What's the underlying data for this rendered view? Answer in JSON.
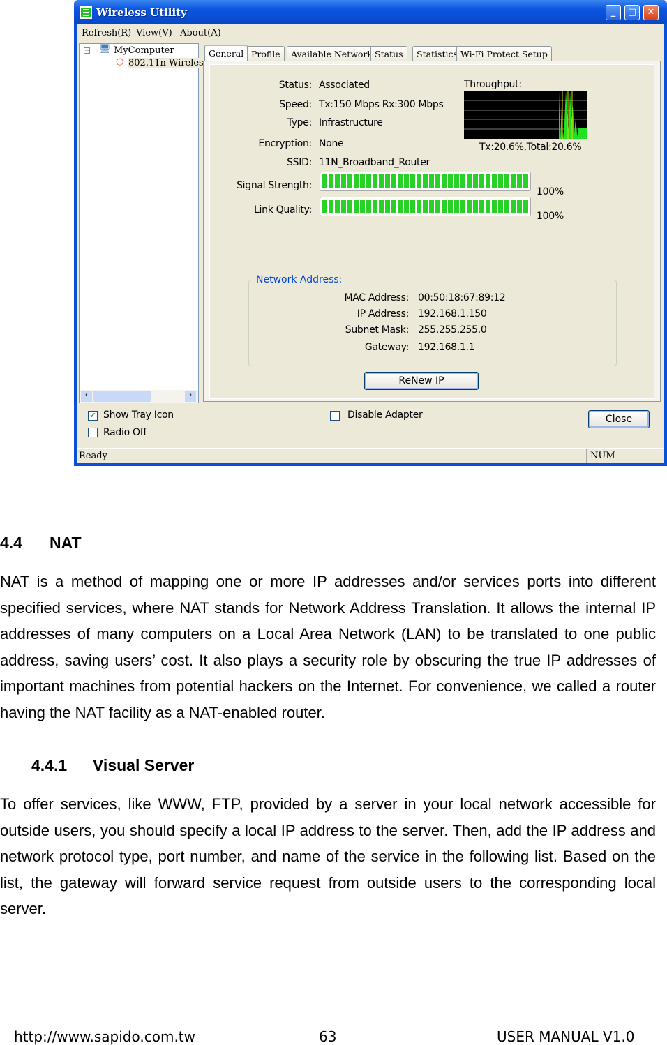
{
  "window": {
    "title": "Wireless Utility",
    "menu": [
      "Refresh(R)",
      "View(V)",
      "About(A)"
    ],
    "tree": {
      "root": "MyComputer",
      "child": "802.11n Wireles"
    },
    "tabs": [
      "General",
      "Profile",
      "Available Network",
      "Status",
      "Statistics",
      "Wi-Fi Protect Setup"
    ],
    "general": {
      "status_label": "Status:",
      "status": "Associated",
      "speed_label": "Speed:",
      "speed": "Tx:150 Mbps Rx:300 Mbps",
      "type_label": "Type:",
      "type": "Infrastructure",
      "encryption_label": "Encryption:",
      "encryption": "None",
      "ssid_label": "SSID:",
      "ssid": "11N_Broadband_Router",
      "signal_label": "Signal Strength:",
      "signal": "100%",
      "link_label": "Link Quality:",
      "link": "100%",
      "throughput_label": "Throughput:",
      "throughput": "Tx:20.6%,Total:20.6%",
      "network_address": {
        "legend": "Network Address:",
        "mac_label": "MAC Address:",
        "mac": "00:50:18:67:89:12",
        "ip_label": "IP Address:",
        "ip": "192.168.1.150",
        "mask_label": "Subnet Mask:",
        "mask": "255.255.255.0",
        "gw_label": "Gateway:",
        "gw": "192.168.1.1"
      },
      "renew": "ReNew IP"
    },
    "show_tray": "Show Tray Icon",
    "radio_off": "Radio Off",
    "disable_adapter": "Disable Adapter",
    "close": "Close",
    "statusbar": {
      "text": "Ready",
      "num": "NUM"
    }
  },
  "section": {
    "num": "4.4",
    "title": "NAT",
    "text": "NAT is a method of mapping one or more IP addresses and/or services ports into different specified services, where NAT stands for Network Address Translation. It allows the internal IP addresses of many computers on a Local Area Network (LAN) to be translated to one public address, saving users’ cost. It also plays a security role by obscuring the true IP addresses of important machines from potential hackers on the Internet. For convenience, we called a router having the NAT facility as a NAT-enabled router."
  },
  "subsection": {
    "num": "4.4.1",
    "title": "Visual Server",
    "text": "To offer services, like WWW, FTP, provided by a server in your local network accessible for outside users, you should specify a local IP address to the server. Then, add the IP address and network protocol type, port number, and name of the service in the following list. Based on the list, the gateway will forward service request from outside users to the corresponding local server."
  },
  "footer": {
    "url": "http://www.sapido.com.tw",
    "page": "63",
    "manual": "USER MANUAL V1.0"
  }
}
